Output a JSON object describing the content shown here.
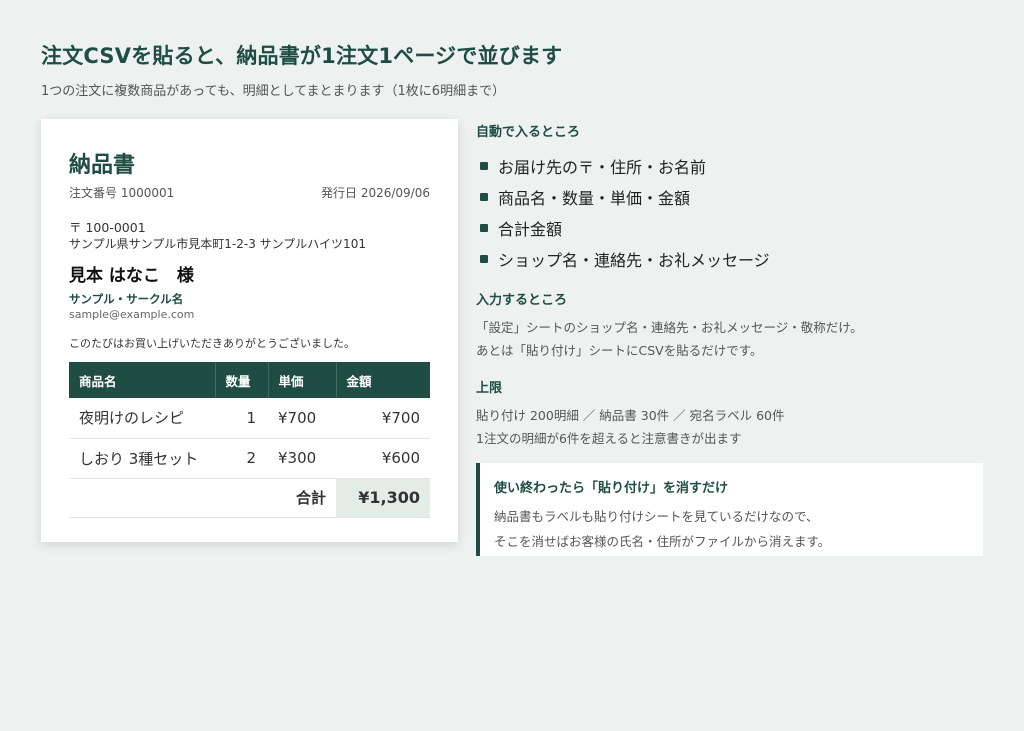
{
  "header": {
    "title": "注文CSVを貼ると、納品書が1注文1ページで並びます",
    "subtitle": "1つの注文に複数商品があっても、明細としてまとまります（1枚に6明細まで）"
  },
  "invoice": {
    "title": "納品書",
    "order_no": "注文番号 1000001",
    "issue_date": "発行日 2026/09/06",
    "zip": "〒 100-0001",
    "address": "サンプル県サンプル市見本町1-2-3 サンプルハイツ101",
    "customer_name": "見本 はなこ　様",
    "circle_name": "サンプル・サークル名",
    "email": "sample@example.com",
    "thanks": "このたびはお買い上げいただきありがとうございました。",
    "columns": [
      "商品名",
      "数量",
      "単価",
      "金額"
    ],
    "rows": [
      {
        "name": "夜明けのレシピ",
        "qty": "1",
        "price": "¥700",
        "amount": "¥700"
      },
      {
        "name": "しおり 3種セット",
        "qty": "2",
        "price": "¥300",
        "amount": "¥600"
      }
    ],
    "total_label": "合計",
    "total_value": "¥1,300"
  },
  "auto": {
    "title": "自動で入るところ",
    "items": [
      "お届け先の〒・住所・お名前",
      "商品名・数量・単価・金額",
      "合計金額",
      "ショップ名・連絡先・お礼メッセージ"
    ]
  },
  "input": {
    "title": "入力するところ",
    "lines": [
      "「設定」シートのショップ名・連絡先・お礼メッセージ・敬称だけ。",
      "あとは「貼り付け」シートにCSVを貼るだけです。"
    ]
  },
  "limits": {
    "title": "上限",
    "lines": [
      "貼り付け 200明細 ／ 納品書 30件 ／ 宛名ラベル 60件",
      "1注文の明細が6件を超えると注意書きが出ます"
    ]
  },
  "callout": {
    "title": "使い終わったら「貼り付け」を消すだけ",
    "lines": [
      "納品書もラベルも貼り付けシートを見ているだけなので、",
      "そこを消せばお客様の氏名・住所がファイルから消えます。"
    ]
  },
  "colors": {
    "accent": "#1f4d43",
    "background": "#edf1ef",
    "total_bg": "#e4ece8"
  }
}
